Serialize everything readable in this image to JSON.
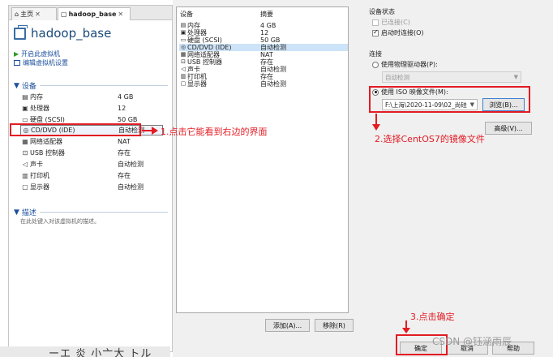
{
  "tabs": [
    {
      "label": "主页"
    },
    {
      "label": "hadoop_base"
    }
  ],
  "vm": {
    "name": "hadoop_base",
    "actions": [
      "开启此虚拟机",
      "编辑虚拟机设置"
    ]
  },
  "sections": {
    "devices": "设备",
    "description": "描述",
    "description_placeholder": "在此处键入对该虚拟机的描述。"
  },
  "left_devices": [
    {
      "icon": "memory-icon",
      "name": "内存",
      "value": "4 GB"
    },
    {
      "icon": "processor-icon",
      "name": "处理器",
      "value": "12"
    },
    {
      "icon": "hard-disk-icon",
      "name": "硬盘 (SCSI)",
      "value": "50 GB"
    },
    {
      "icon": "cd-dvd-icon",
      "name": "CD/DVD (IDE)",
      "value": "自动检测"
    },
    {
      "icon": "network-adapter-icon",
      "name": "网络适配器",
      "value": "NAT"
    },
    {
      "icon": "usb-controller-icon",
      "name": "USB 控制器",
      "value": "存在"
    },
    {
      "icon": "sound-card-icon",
      "name": "声卡",
      "value": "自动检测"
    },
    {
      "icon": "printer-icon",
      "name": "打印机",
      "value": "存在"
    },
    {
      "icon": "display-icon",
      "name": "显示器",
      "value": "自动检测"
    }
  ],
  "settings": {
    "list_header_device": "设备",
    "list_header_summary": "摘要",
    "items": [
      {
        "icon": "memory-icon",
        "name": "内存",
        "value": "4 GB"
      },
      {
        "icon": "processor-icon",
        "name": "处理器",
        "value": "12"
      },
      {
        "icon": "hard-disk-icon",
        "name": "硬盘 (SCSI)",
        "value": "50 GB"
      },
      {
        "icon": "cd-dvd-icon",
        "name": "CD/DVD (IDE)",
        "value": "自动检测"
      },
      {
        "icon": "network-adapter-icon",
        "name": "网络适配器",
        "value": "NAT"
      },
      {
        "icon": "usb-controller-icon",
        "name": "USB 控制器",
        "value": "存在"
      },
      {
        "icon": "sound-card-icon",
        "name": "声卡",
        "value": "自动检测"
      },
      {
        "icon": "printer-icon",
        "name": "打印机",
        "value": "存在"
      },
      {
        "icon": "display-icon",
        "name": "显示器",
        "value": "自动检测"
      }
    ],
    "add_button": "添加(A)...",
    "remove_button": "移除(R)",
    "device_status": {
      "title": "设备状态",
      "connected": "已连接(C)",
      "connected_checked": false,
      "connect_at_power_on": "启动时连接(O)",
      "connect_at_power_on_checked": true
    },
    "connection": {
      "title": "连接",
      "physical_drive": "使用物理驱动器(P):",
      "physical_drive_value": "自动检测",
      "iso_image": "使用 ISO 映像文件(M):",
      "iso_path": "F:\\上海\\2020-11-09\\02_尚硅",
      "browse_button": "浏览(B)...",
      "advanced_button": "高级(V)..."
    },
    "ok_button": "确定",
    "cancel_button": "取消",
    "help_button": "帮助"
  },
  "annotations": {
    "step1": "1.点击它能看到右边的界面",
    "step2": "2.选择CentOS7的镜像文件",
    "step3": "3.点击确定"
  },
  "colors": {
    "annotation": "#e31b23",
    "link": "#1c4f9e",
    "selection": "#cde3f7"
  },
  "watermark": "CSDN @钰涵雨辰",
  "bottom_fragment": "ーエ 炎 小亠大 トル"
}
